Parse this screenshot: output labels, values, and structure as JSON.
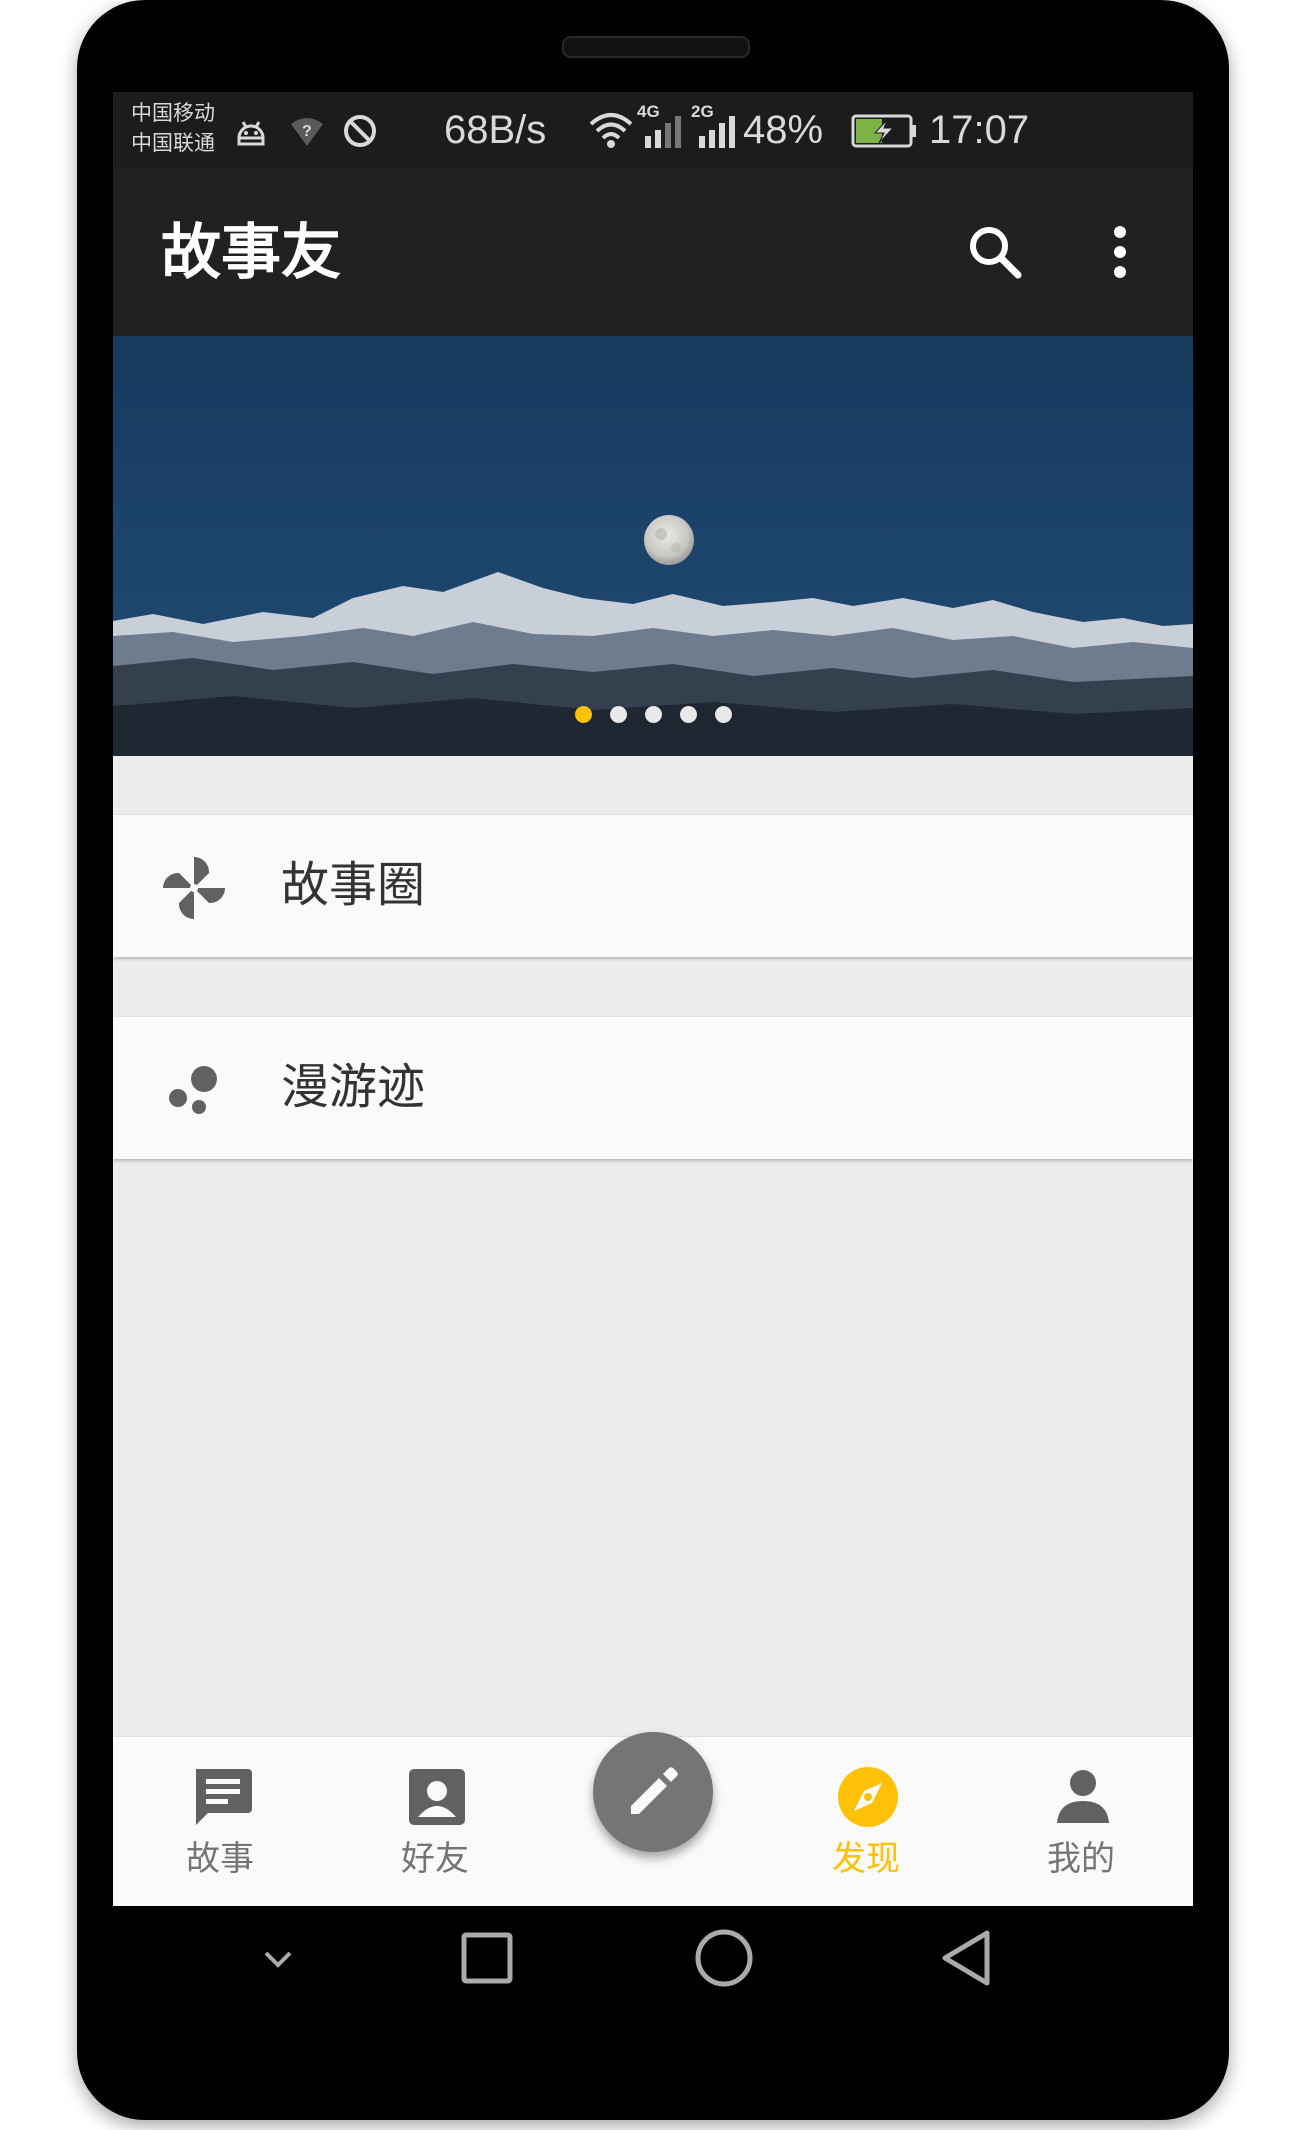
{
  "status_bar": {
    "carrier_1": "中国移动",
    "carrier_2": "中国联通",
    "network_speed": "68B/s",
    "network_4g": "4G",
    "network_2g": "2G",
    "battery": "48%",
    "time": "17:07",
    "icons": [
      "android-icon",
      "wifi-unknown-icon",
      "sync-disabled-icon",
      "wifi-icon",
      "signal-icon",
      "battery-charging-icon"
    ]
  },
  "toolbar": {
    "title": "故事友",
    "actions": [
      "search-icon",
      "more-vert-icon"
    ]
  },
  "banner": {
    "image": "moon-over-snowy-mountains",
    "slide_count": 5,
    "active_index": 0
  },
  "list": {
    "items": [
      {
        "label": "故事圈",
        "icon": "pinwheel-icon"
      },
      {
        "label": "漫游迹",
        "icon": "bubbles-icon"
      }
    ]
  },
  "bottom_nav": {
    "items": [
      {
        "label": "故事",
        "icon": "message-icon",
        "active": false
      },
      {
        "label": "好友",
        "icon": "contact-icon",
        "active": false
      },
      {
        "label": "发现",
        "icon": "compass-icon",
        "active": true
      },
      {
        "label": "我的",
        "icon": "person-icon",
        "active": false
      }
    ],
    "fab_icon": "pencil-icon"
  },
  "colors": {
    "accent": "#ffc107",
    "toolbar": "#212121",
    "statusbar": "#1c1c1c",
    "background": "#ececec",
    "inactive": "#757575"
  }
}
